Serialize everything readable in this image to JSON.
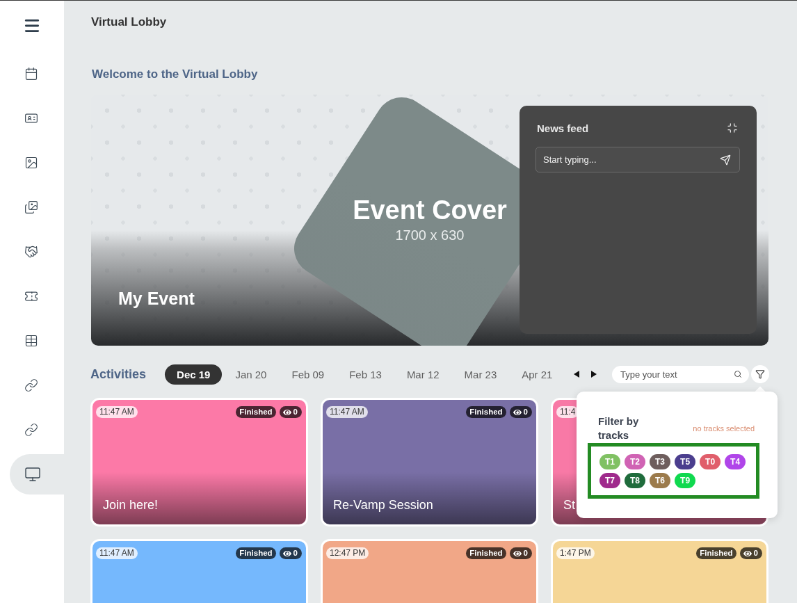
{
  "sidebar": {
    "items": [
      {
        "kind": "calendar",
        "selected": false
      },
      {
        "kind": "contact-card",
        "selected": false
      },
      {
        "kind": "image",
        "selected": false
      },
      {
        "kind": "gallery",
        "selected": false
      },
      {
        "kind": "handshake",
        "selected": false
      },
      {
        "kind": "ticket",
        "selected": false
      },
      {
        "kind": "table",
        "selected": false
      },
      {
        "kind": "link",
        "selected": false
      },
      {
        "kind": "link",
        "selected": false
      },
      {
        "kind": "monitor",
        "selected": true
      }
    ]
  },
  "header": {
    "title": "Virtual Lobby"
  },
  "welcome": "Welcome to the Virtual Lobby",
  "cover": {
    "title": "Event Cover",
    "subtitle": "1700 x 630",
    "event_name": "My Event"
  },
  "news_feed": {
    "title": "News feed",
    "input": {
      "placeholder": "Start typing..."
    }
  },
  "activities": {
    "title": "Activities",
    "dates": [
      {
        "label": "Dec 19",
        "selected": true
      },
      {
        "label": "Jan 20",
        "selected": false
      },
      {
        "label": "Feb 09",
        "selected": false
      },
      {
        "label": "Feb 13",
        "selected": false
      },
      {
        "label": "Mar 12",
        "selected": false
      },
      {
        "label": "Mar 23",
        "selected": false
      },
      {
        "label": "Apr 21",
        "selected": false
      }
    ],
    "search": {
      "placeholder": "Type your text"
    },
    "cards": [
      {
        "time": "11:47 AM",
        "status": "Finished",
        "views": "0",
        "title": "Join here!",
        "color": "#fc79a7"
      },
      {
        "time": "11:47 AM",
        "status": "Finished",
        "views": "0",
        "title": "Re-Vamp Session",
        "color": "#796fa6"
      },
      {
        "time": "11:4",
        "title": "St",
        "color": "#f879a6"
      },
      {
        "time": "11:47 AM",
        "status": "Finished",
        "views": "0",
        "color": "#75b8fd"
      },
      {
        "time": "12:47 PM",
        "status": "Finished",
        "views": "0",
        "color": "#f1a787"
      },
      {
        "time": "1:47 PM",
        "status": "Finished",
        "views": "0",
        "color": "#f5d696"
      }
    ]
  },
  "filter_popup": {
    "title": "Filter by tracks",
    "status": "no tracks selected",
    "tracks": [
      {
        "label": "T1",
        "color": "#80c163"
      },
      {
        "label": "T2",
        "color": "#d063b4"
      },
      {
        "label": "T3",
        "color": "#6e5e5d"
      },
      {
        "label": "T5",
        "color": "#4b3e8e"
      },
      {
        "label": "T0",
        "color": "#e05e6b"
      },
      {
        "label": "T4",
        "color": "#b045e9"
      },
      {
        "label": "T7",
        "color": "#9f2a8c"
      },
      {
        "label": "T8",
        "color": "#1f6c3c"
      },
      {
        "label": "T6",
        "color": "#9c7b4c"
      },
      {
        "label": "T9",
        "color": "#10d94f"
      }
    ]
  }
}
